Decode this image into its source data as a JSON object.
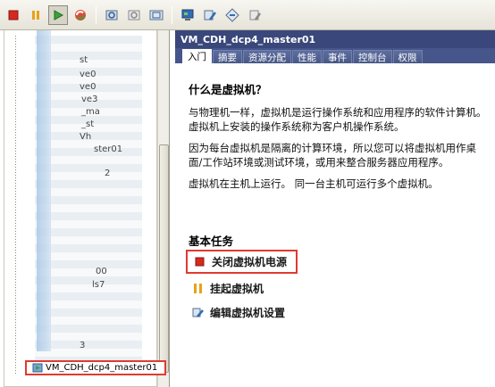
{
  "toolbar": {
    "buttons": [
      {
        "name": "power-off",
        "icon": "stop-square",
        "color": "#d42a1f"
      },
      {
        "name": "suspend",
        "icon": "pause-bars",
        "color": "#e5a318"
      },
      {
        "name": "power-on",
        "icon": "play-triangle",
        "color": "#3aa33a"
      },
      {
        "name": "reset",
        "icon": "refresh-arrows",
        "color": "#2a8a2a"
      }
    ]
  },
  "tree": {
    "fragments": [
      "st",
      "ve0",
      "ve0",
      "ve3",
      "_ma",
      "_st",
      "Vh",
      "ster01",
      "2",
      "00",
      "ls7",
      "3"
    ],
    "selected_node_label": "VM_CDH_dcp4_master01"
  },
  "panel": {
    "title": "VM_CDH_dcp4_master01",
    "tabs": [
      "入门",
      "摘要",
      "资源分配",
      "性能",
      "事件",
      "控制台",
      "权限"
    ],
    "active_tab": 0
  },
  "content": {
    "heading": "什么是虚拟机？",
    "paragraphs": [
      "与物理机一样，虚拟机是运行操作系统和应用程序的软件计算机。 虚拟机上安装的操作系统称为客户机操作系统。",
      "因为每台虚拟机是隔离的计算环境，所以您可以将虚拟机用作桌面/工作站环境或测试环境，或用来整合服务器应用程序。",
      "虚拟机在主机上运行。 同一台主机可运行多个虚拟机。"
    ]
  },
  "tasks": {
    "heading": "基本任务",
    "items": [
      {
        "label": "关闭虚拟机电源",
        "icon": "power-off-icon",
        "color": "#d42a1f"
      },
      {
        "label": "挂起虚拟机",
        "icon": "suspend-icon",
        "color": "#e5a318"
      },
      {
        "label": "编辑虚拟机设置",
        "icon": "edit-settings-icon",
        "color": "#2f6db5"
      }
    ]
  },
  "colors": {
    "title_bar": "#39477a",
    "highlight_border": "#e03a2f"
  }
}
